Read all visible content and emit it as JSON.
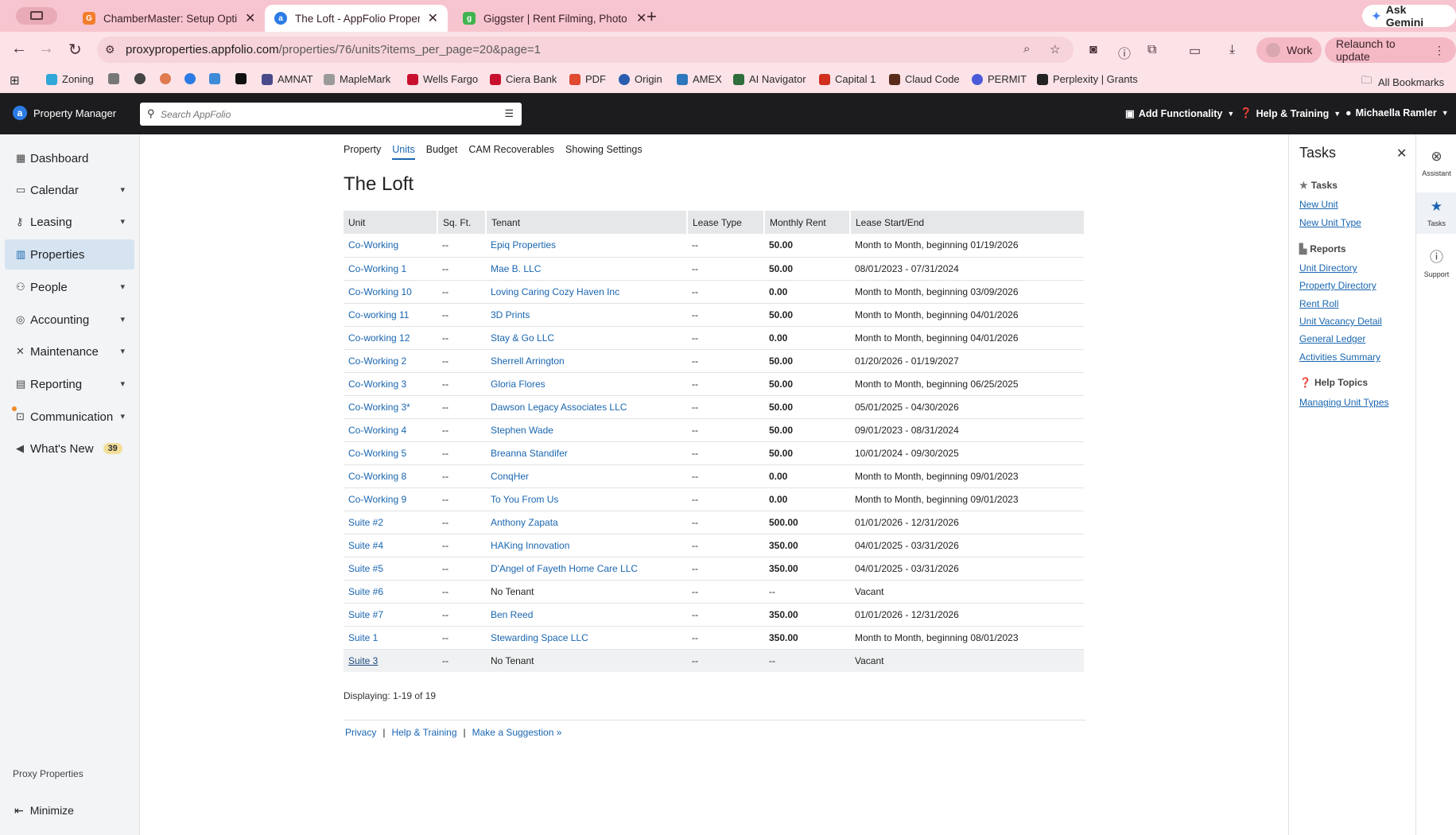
{
  "browser": {
    "tabs": [
      {
        "title": "ChamberMaster: Setup Optio",
        "icon": "chambermaster-favicon",
        "color": "#f27d2b"
      },
      {
        "title": "The Loft - AppFolio Property",
        "icon": "appfolio-favicon",
        "color": "#2c7be5"
      },
      {
        "title": "Giggster | Rent Filming, Photo",
        "icon": "giggster-favicon",
        "color": "#3fb34f"
      }
    ],
    "new_tab": "+",
    "ask_gemini": "Ask Gemini",
    "url_host": "proxyproperties.appfolio.com",
    "url_path": "/properties/76/units?items_per_page=20&page=1",
    "profile": "Work",
    "relaunch": "Relaunch to update",
    "bookmarks": [
      "Zoning",
      "AMNAT",
      "MapleMark",
      "Wells Fargo",
      "Ciera Bank",
      "PDF",
      "Origin",
      "AMEX",
      "AI Navigator",
      "Capital 1",
      "Claud Code",
      "PERMIT",
      "Perplexity | Grants"
    ],
    "all_bookmarks": "All Bookmarks"
  },
  "header": {
    "app_name": "Property Manager",
    "search_placeholder": "Search AppFolio",
    "add_functionality": "Add Functionality",
    "help_training": "Help & Training",
    "user": "Michaella Ramler"
  },
  "sidebar": {
    "items": [
      {
        "label": "Dashboard",
        "icon": "dashboard-icon"
      },
      {
        "label": "Calendar",
        "icon": "calendar-icon"
      },
      {
        "label": "Leasing",
        "icon": "key-icon"
      },
      {
        "label": "Properties",
        "icon": "building-icon"
      },
      {
        "label": "People",
        "icon": "person-icon"
      },
      {
        "label": "Accounting",
        "icon": "accounting-icon"
      },
      {
        "label": "Maintenance",
        "icon": "tools-icon"
      },
      {
        "label": "Reporting",
        "icon": "reporting-icon"
      },
      {
        "label": "Communication",
        "icon": "inbox-icon"
      },
      {
        "label": "What's New",
        "icon": "megaphone-icon",
        "badge": "39"
      }
    ],
    "company": "Proxy Properties",
    "minimize": "Minimize"
  },
  "main": {
    "subnav": [
      "Property",
      "Units",
      "Budget",
      "CAM Recoverables",
      "Showing Settings"
    ],
    "active_subnav": "Units",
    "title": "The Loft",
    "columns": [
      "Unit",
      "Sq. Ft.",
      "Tenant",
      "Lease Type",
      "Monthly Rent",
      "Lease Start/End"
    ],
    "rows": [
      {
        "unit": "Co-Working",
        "sqft": "--",
        "tenant": "Epiq Properties",
        "lease_type": "--",
        "rent": "50.00",
        "lease": "Month to Month, beginning 01/19/2026"
      },
      {
        "unit": "Co-Working 1",
        "sqft": "--",
        "tenant": "Mae B. LLC",
        "lease_type": "--",
        "rent": "50.00",
        "lease": "08/01/2023 - 07/31/2024"
      },
      {
        "unit": "Co-Working 10",
        "sqft": "--",
        "tenant": "Loving Caring Cozy Haven Inc",
        "lease_type": "--",
        "rent": "0.00",
        "lease": "Month to Month, beginning 03/09/2026"
      },
      {
        "unit": "Co-working 11",
        "sqft": "--",
        "tenant": "3D Prints",
        "lease_type": "--",
        "rent": "50.00",
        "lease": "Month to Month, beginning 04/01/2026"
      },
      {
        "unit": "Co-working 12",
        "sqft": "--",
        "tenant": "Stay & Go LLC",
        "lease_type": "--",
        "rent": "0.00",
        "lease": "Month to Month, beginning 04/01/2026"
      },
      {
        "unit": "Co-Working 2",
        "sqft": "--",
        "tenant": "Sherrell Arrington",
        "lease_type": "--",
        "rent": "50.00",
        "lease": "01/20/2026 - 01/19/2027"
      },
      {
        "unit": "Co-Working 3",
        "sqft": "--",
        "tenant": "Gloria Flores",
        "lease_type": "--",
        "rent": "50.00",
        "lease": "Month to Month, beginning 06/25/2025"
      },
      {
        "unit": "Co-Working 3*",
        "sqft": "--",
        "tenant": "Dawson Legacy Associates LLC",
        "lease_type": "--",
        "rent": "50.00",
        "lease": "05/01/2025 - 04/30/2026"
      },
      {
        "unit": "Co-Working 4",
        "sqft": "--",
        "tenant": "Stephen Wade",
        "lease_type": "--",
        "rent": "50.00",
        "lease": "09/01/2023 - 08/31/2024"
      },
      {
        "unit": "Co-Working 5",
        "sqft": "--",
        "tenant": "Breanna Standifer",
        "lease_type": "--",
        "rent": "50.00",
        "lease": "10/01/2024 - 09/30/2025"
      },
      {
        "unit": "Co-Working 8",
        "sqft": "--",
        "tenant": "ConqHer",
        "lease_type": "--",
        "rent": "0.00",
        "lease": "Month to Month, beginning 09/01/2023"
      },
      {
        "unit": "Co-Working 9",
        "sqft": "--",
        "tenant": "To You From Us",
        "lease_type": "--",
        "rent": "0.00",
        "lease": "Month to Month, beginning 09/01/2023"
      },
      {
        "unit": "Suite #2",
        "sqft": "--",
        "tenant": "Anthony Zapata",
        "lease_type": "--",
        "rent": "500.00",
        "lease": "01/01/2026 - 12/31/2026"
      },
      {
        "unit": "Suite #4",
        "sqft": "--",
        "tenant": "HAKing Innovation",
        "lease_type": "--",
        "rent": "350.00",
        "lease": "04/01/2025 - 03/31/2026"
      },
      {
        "unit": "Suite #5",
        "sqft": "--",
        "tenant": "D'Angel of Fayeth Home Care LLC",
        "lease_type": "--",
        "rent": "350.00",
        "lease": "04/01/2025 - 03/31/2026"
      },
      {
        "unit": "Suite #6",
        "sqft": "--",
        "tenant": "No Tenant",
        "lease_type": "--",
        "rent": "--",
        "lease": "Vacant"
      },
      {
        "unit": "Suite #7",
        "sqft": "--",
        "tenant": "Ben Reed",
        "lease_type": "--",
        "rent": "350.00",
        "lease": "01/01/2026 - 12/31/2026"
      },
      {
        "unit": "Suite 1",
        "sqft": "--",
        "tenant": "Stewarding Space LLC",
        "lease_type": "--",
        "rent": "350.00",
        "lease": "Month to Month, beginning 08/01/2023"
      },
      {
        "unit": "Suite 3",
        "sqft": "--",
        "tenant": "No Tenant",
        "lease_type": "--",
        "rent": "--",
        "lease": "Vacant"
      }
    ],
    "displaying": "Displaying: 1-19 of 19",
    "footer_links": [
      "Privacy",
      "Help & Training",
      "Make a Suggestion »"
    ]
  },
  "tasks": {
    "title": "Tasks",
    "tasks_heading": "Tasks",
    "task_links": [
      "New Unit",
      "New Unit Type"
    ],
    "reports_heading": "Reports",
    "report_links": [
      "Unit Directory",
      "Property Directory",
      "Rent Roll",
      "Unit Vacancy Detail",
      "General Ledger",
      "Activities Summary"
    ],
    "help_heading": "Help Topics",
    "help_links": [
      "Managing Unit Types"
    ]
  },
  "rail": [
    {
      "label": "Assistant",
      "icon": "assistant-icon"
    },
    {
      "label": "Tasks",
      "icon": "star-icon"
    },
    {
      "label": "Support",
      "icon": "help-icon"
    }
  ]
}
